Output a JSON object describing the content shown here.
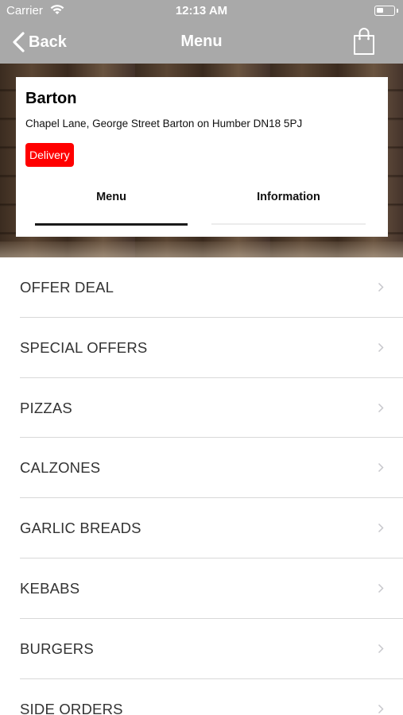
{
  "status_bar": {
    "carrier": "Carrier",
    "time": "12:13 AM",
    "wifi_icon": "wifi-icon",
    "battery_icon": "battery-icon"
  },
  "nav": {
    "back_label": "Back",
    "title": "Menu",
    "cart_icon": "shopping-bag-icon",
    "bar_color": "#a9a9a9"
  },
  "restaurant": {
    "name": "Barton",
    "address": "Chapel Lane, George Street Barton on Humber DN18 5PJ",
    "badge": "Delivery",
    "badge_color": "#ff0000"
  },
  "tabs": [
    {
      "label": "Menu",
      "selected": true
    },
    {
      "label": "Information",
      "selected": false
    }
  ],
  "categories": [
    {
      "label": "OFFER DEAL"
    },
    {
      "label": "SPECIAL OFFERS"
    },
    {
      "label": "PIZZAS"
    },
    {
      "label": "CALZONES"
    },
    {
      "label": "GARLIC BREADS"
    },
    {
      "label": "KEBABS"
    },
    {
      "label": "BURGERS"
    },
    {
      "label": "SIDE ORDERS"
    }
  ]
}
